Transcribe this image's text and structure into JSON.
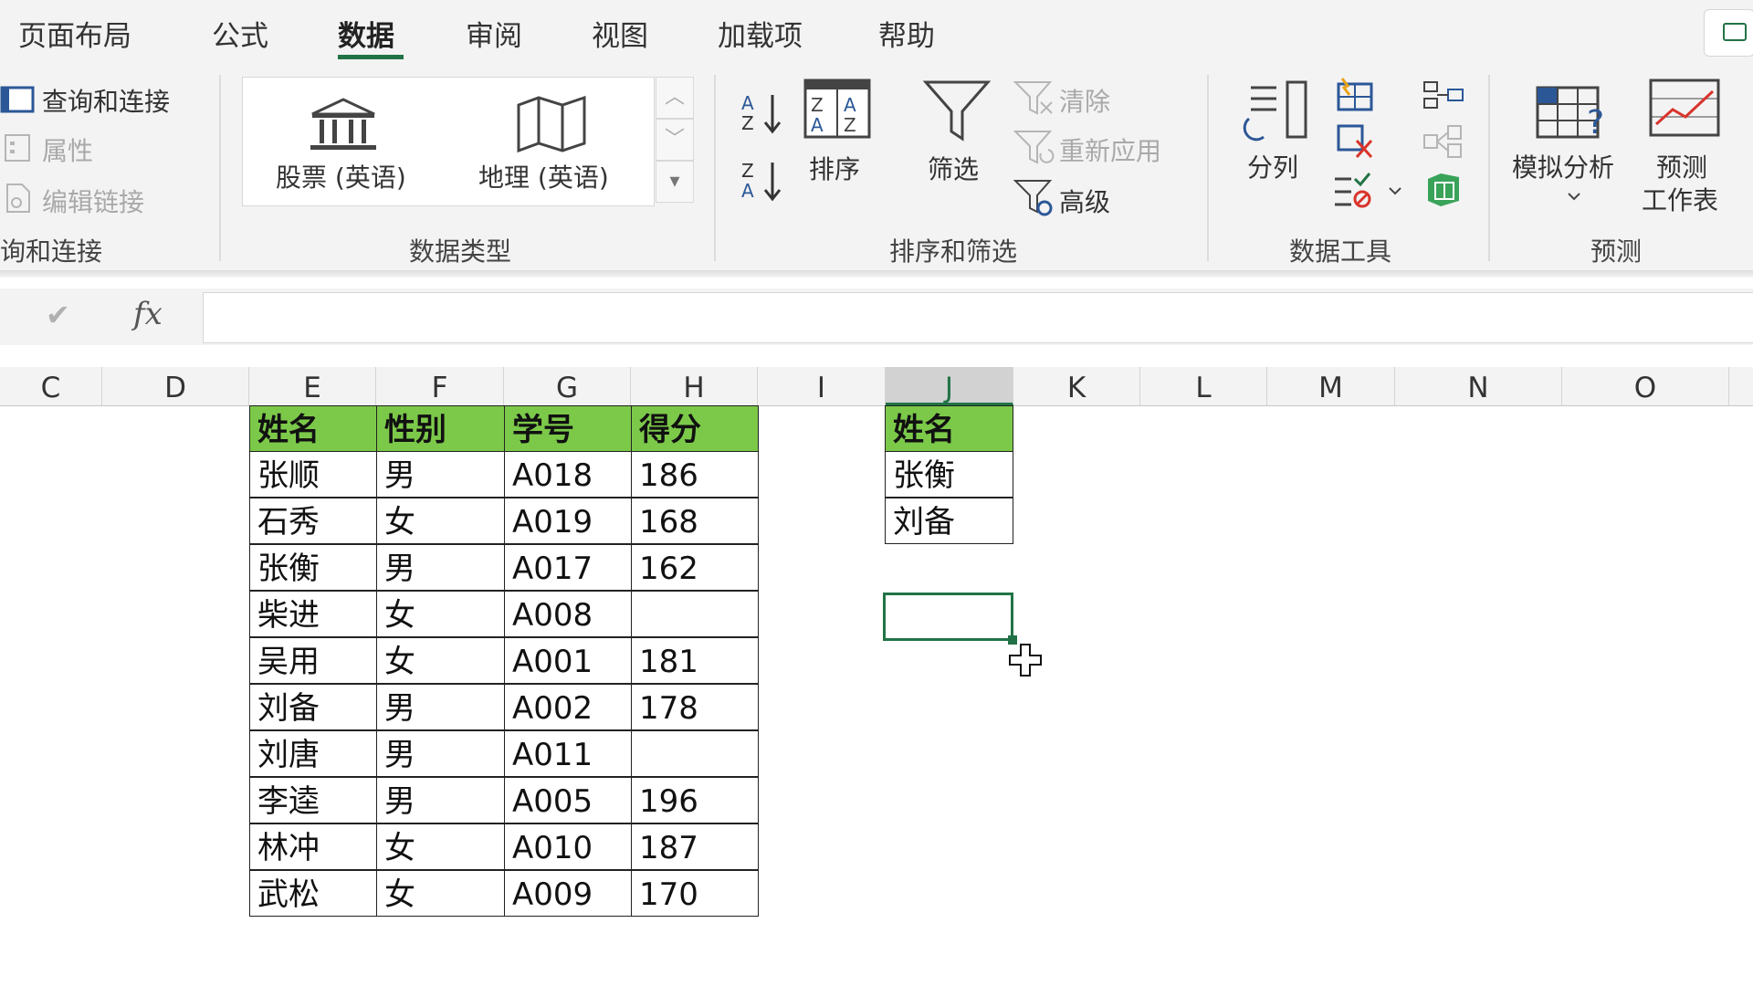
{
  "tabs": [
    {
      "label": "页面布局",
      "active": false
    },
    {
      "label": "公式",
      "active": false
    },
    {
      "label": "数据",
      "active": true
    },
    {
      "label": "审阅",
      "active": false
    },
    {
      "label": "视图",
      "active": false
    },
    {
      "label": "加载项",
      "active": false
    },
    {
      "label": "帮助",
      "active": false
    }
  ],
  "ribbon": {
    "query_group": {
      "items": [
        "查询和连接",
        "属性",
        "编辑链接"
      ],
      "label": "询和连接"
    },
    "data_types": {
      "stocks": "股票 (英语)",
      "geography": "地理 (英语)",
      "label": "数据类型"
    },
    "sort_filter": {
      "sort": "排序",
      "filter": "筛选",
      "clear": "清除",
      "reapply": "重新应用",
      "advanced": "高级",
      "label": "排序和筛选"
    },
    "data_tools": {
      "text_to_columns": "分列",
      "label": "数据工具"
    },
    "forecast": {
      "what_if": "模拟分析",
      "forecast_sheet_1": "预测",
      "forecast_sheet_2": "工作表",
      "label": "预测"
    }
  },
  "formula_bar": {
    "fx": "fx",
    "value": ""
  },
  "columns": [
    "C",
    "D",
    "E",
    "F",
    "G",
    "H",
    "I",
    "J",
    "K",
    "L",
    "M",
    "N",
    "O"
  ],
  "selected_column": "J",
  "main_table": {
    "headers": [
      "姓名",
      "性别",
      "学号",
      "得分"
    ],
    "rows": [
      [
        "张顺",
        "男",
        "A018",
        "186"
      ],
      [
        "石秀",
        "女",
        "A019",
        "168"
      ],
      [
        "张衡",
        "男",
        "A017",
        "162"
      ],
      [
        "柴进",
        "女",
        "A008",
        ""
      ],
      [
        "吴用",
        "女",
        "A001",
        "181"
      ],
      [
        "刘备",
        "男",
        "A002",
        "178"
      ],
      [
        "刘唐",
        "男",
        "A011",
        ""
      ],
      [
        "李逵",
        "男",
        "A005",
        "196"
      ],
      [
        "林冲",
        "女",
        "A010",
        "187"
      ],
      [
        "武松",
        "女",
        "A009",
        "170"
      ]
    ]
  },
  "criteria_table": {
    "header": "姓名",
    "rows": [
      "张衡",
      "刘备"
    ]
  },
  "colors": {
    "accent": "#217346",
    "header_fill": "#7cc94a"
  }
}
